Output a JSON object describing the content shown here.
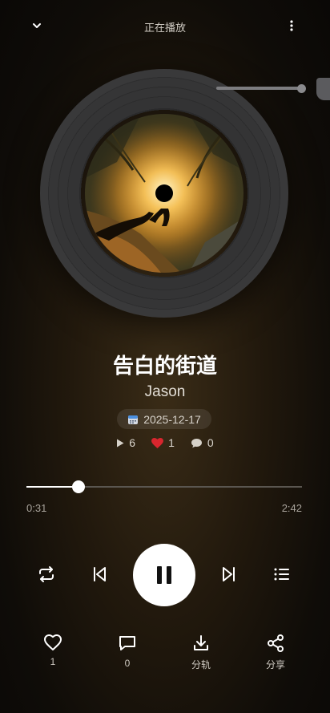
{
  "header": {
    "title": "正在播放",
    "collapse_icon": "chevron-down-icon",
    "more_icon": "more-vertical-icon"
  },
  "song": {
    "title": "告白的街道",
    "artist": "Jason",
    "date": "2025-12-17"
  },
  "stats": {
    "plays": "6",
    "likes": "1",
    "comments": "0"
  },
  "progress": {
    "current": "0:31",
    "total": "2:42",
    "fraction": 0.19
  },
  "controls": {
    "repeat_icon": "repeat-icon",
    "prev_icon": "skip-previous-icon",
    "play_state": "playing",
    "next_icon": "skip-next-icon",
    "playlist_icon": "playlist-icon"
  },
  "actions": [
    {
      "icon": "heart-outline-icon",
      "label": "1"
    },
    {
      "icon": "comment-icon",
      "label": "0"
    },
    {
      "icon": "download-icon",
      "label": "分轨"
    },
    {
      "icon": "share-icon",
      "label": "分享"
    }
  ],
  "colors": {
    "accent": "#ffffff",
    "like": "#d8262e"
  }
}
